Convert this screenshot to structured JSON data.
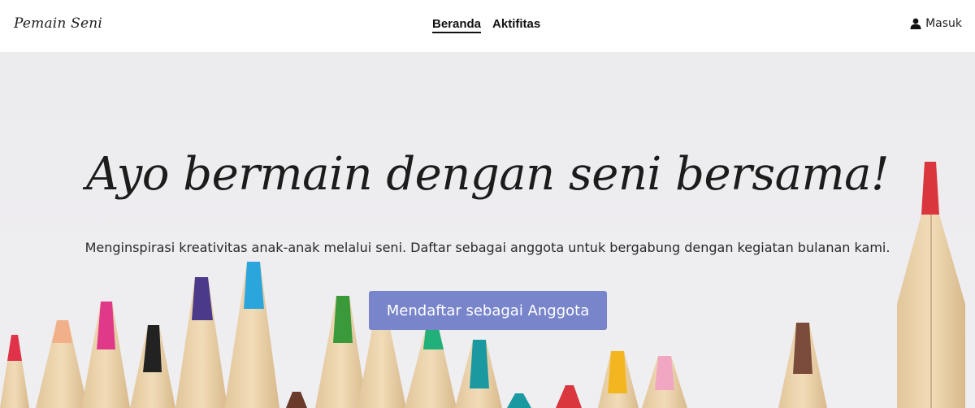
{
  "header": {
    "brand": "Pemain Seni",
    "nav": [
      {
        "label": "Beranda",
        "active": true
      },
      {
        "label": "Aktifitas",
        "active": false
      }
    ],
    "login": {
      "label": "Masuk",
      "icon": "user-icon"
    }
  },
  "hero": {
    "headline": "Ayo bermain dengan seni bersama!",
    "subtext": "Menginspirasi kreativitas anak-anak melalui seni. Daftar sebagai anggota untuk bergabung dengan kegiatan bulanan kami.",
    "cta_label": "Mendaftar sebagai Anggota"
  },
  "colors": {
    "cta_background": "#7985cb",
    "hero_background": "#eeedf0",
    "pencil_wood": "#e9d2ac",
    "pencil_tips": [
      "#e0334a",
      "#f2b08a",
      "#e0398a",
      "#222222",
      "#4b3a8a",
      "#2aa6dc",
      "#3a9a3a",
      "#22b07a",
      "#1a9aa0",
      "#f4b620",
      "#f1a6c2",
      "#7a4a3a",
      "#d9363e"
    ]
  }
}
